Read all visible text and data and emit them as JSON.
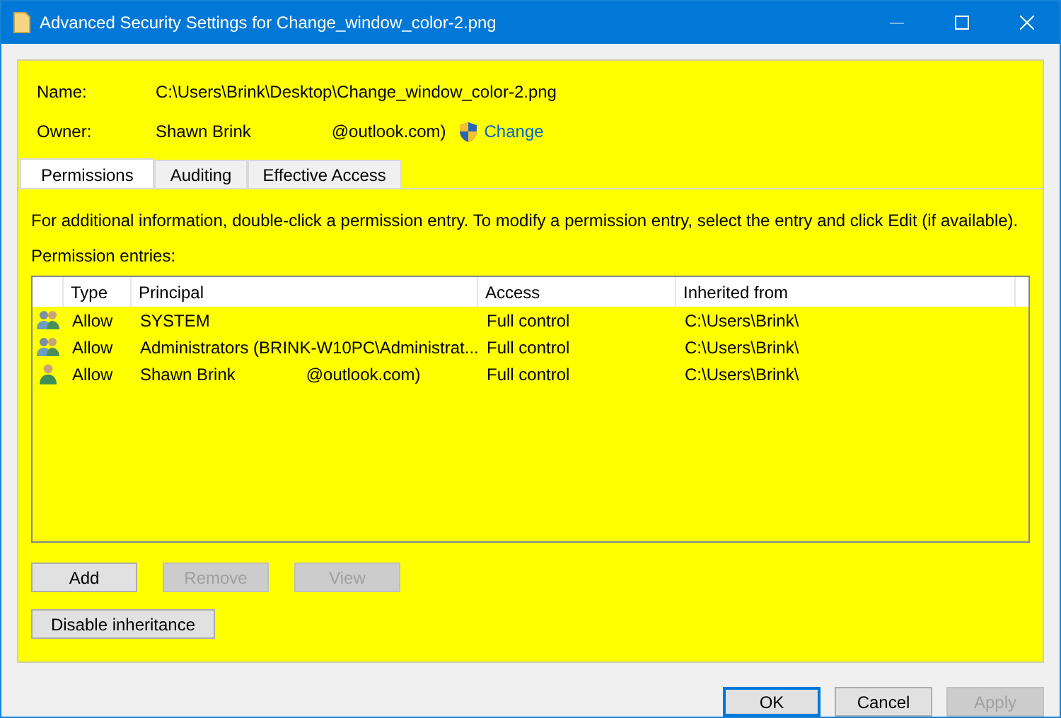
{
  "window": {
    "title": "Advanced Security Settings for Change_window_color-2.png"
  },
  "properties": {
    "name_label": "Name:",
    "name_value": "C:\\Users\\Brink\\Desktop\\Change_window_color-2.png",
    "owner_label": "Owner:",
    "owner_name": "Shawn Brink",
    "owner_email": "@outlook.com)",
    "change_link": "Change"
  },
  "tabs": [
    {
      "label": "Permissions",
      "selected": true
    },
    {
      "label": "Auditing",
      "selected": false
    },
    {
      "label": "Effective Access",
      "selected": false
    }
  ],
  "info_text": "For additional information, double-click a permission entry. To modify a permission entry, select the entry and click Edit (if available).",
  "entries_label": "Permission entries:",
  "table": {
    "columns": [
      "Type",
      "Principal",
      "Access",
      "Inherited from"
    ],
    "rows": [
      {
        "kind": "group",
        "type": "Allow",
        "principal": "SYSTEM",
        "access": "Full control",
        "inherited_from": "C:\\Users\\Brink\\"
      },
      {
        "kind": "group",
        "type": "Allow",
        "principal": "Administrators (BRINK-W10PC\\Administrat...",
        "access": "Full control",
        "inherited_from": "C:\\Users\\Brink\\"
      },
      {
        "kind": "user",
        "type": "Allow",
        "principal": "Shawn Brink",
        "principal_suffix": "@outlook.com)",
        "access": "Full control",
        "inherited_from": "C:\\Users\\Brink\\"
      }
    ]
  },
  "entry_buttons": [
    {
      "label": "Add",
      "disabled": false
    },
    {
      "label": "Remove",
      "disabled": true
    },
    {
      "label": "View",
      "disabled": true
    }
  ],
  "inheritance_button": {
    "label": "Disable inheritance",
    "disabled": false
  },
  "dialog_buttons": [
    {
      "label": "OK",
      "disabled": false,
      "default": true
    },
    {
      "label": "Cancel",
      "disabled": false,
      "default": false
    },
    {
      "label": "Apply",
      "disabled": true,
      "default": false
    }
  ]
}
